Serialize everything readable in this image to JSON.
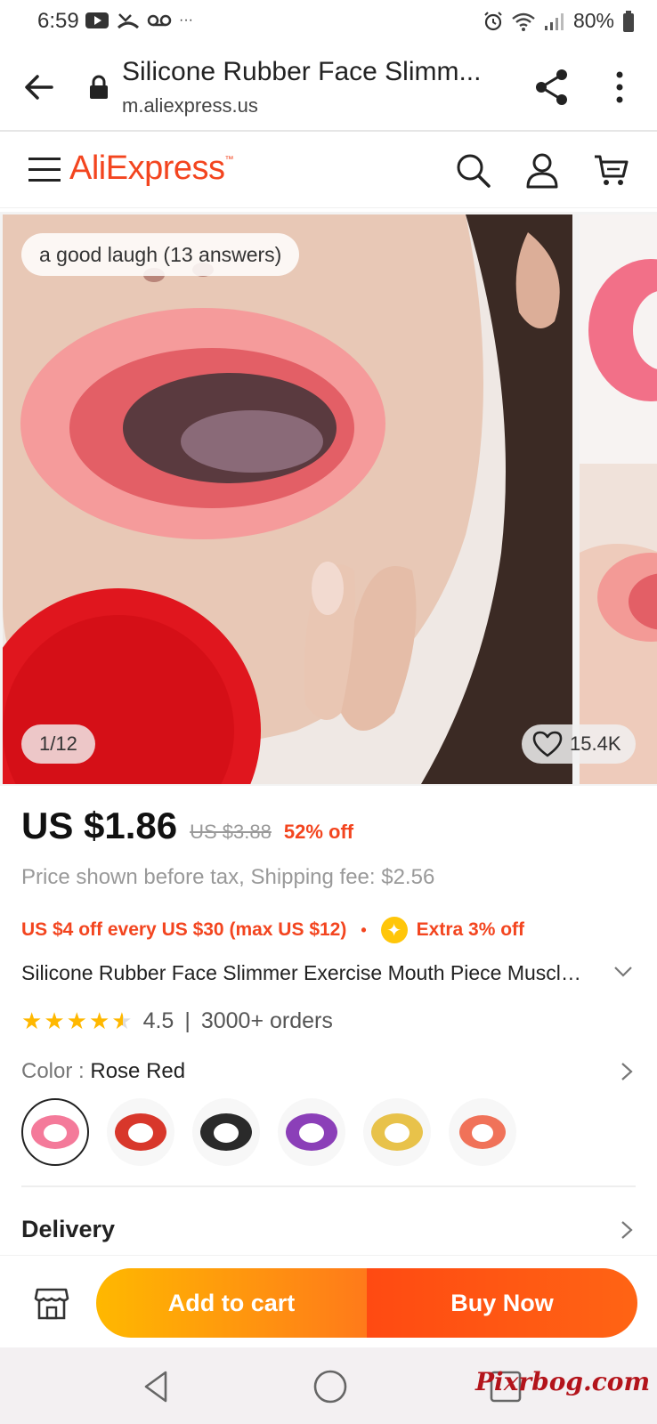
{
  "status_bar": {
    "time": "6:59",
    "dots": "···",
    "battery": "80%"
  },
  "browser": {
    "page_title": "Silicone Rubber Face Slimm...",
    "domain": "m.aliexpress.us"
  },
  "site": {
    "logo_text": "AliExpress",
    "logo_tm": "™"
  },
  "gallery": {
    "qa_label": "a good laugh (13 answers)",
    "page_indicator": "1/12",
    "wishlist_count": "15.4K"
  },
  "price": {
    "current": "US $1.86",
    "original": "US $3.88",
    "discount": "52% off"
  },
  "tax_shipping": "Price shown before tax, Shipping fee: $2.56",
  "promo": {
    "coupon": "US $4 off every US $30 (max US $12)",
    "separator": "•",
    "extra": "Extra 3% off"
  },
  "product_title": "Silicone Rubber Face Slimmer Exercise Mouth Piece Muscle Anti Wrinkle Lip Trainer",
  "rating": {
    "score": "4.5",
    "separator": "|",
    "orders": "3000+ orders",
    "stars_value": 4.5
  },
  "color": {
    "label": "Color",
    "separator": " : ",
    "value": "Rose Red"
  },
  "swatches": [
    {
      "name": "Rose Red",
      "color": "#f47a9a"
    },
    {
      "name": "Red",
      "color": "#d8372b"
    },
    {
      "name": "Black",
      "color": "#2a2a2a"
    },
    {
      "name": "Purple",
      "color": "#8b3fb8"
    },
    {
      "name": "Yellow",
      "color": "#e8c24a"
    },
    {
      "name": "Orange",
      "color": "#f07259"
    }
  ],
  "delivery_label": "Delivery",
  "actions": {
    "add_to_cart": "Add to cart",
    "buy_now": "Buy Now"
  },
  "watermark": "Pixrbog.com",
  "colors": {
    "brand": "#f3451f",
    "star": "#ffb800",
    "buy_now": "#ff4a12",
    "add_cart": "#ffb800"
  }
}
